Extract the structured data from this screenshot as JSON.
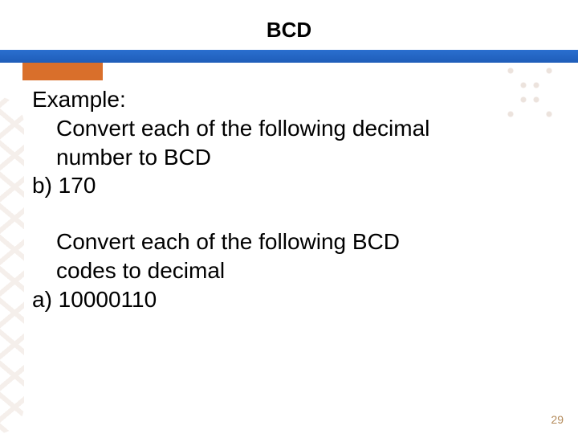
{
  "header": {
    "title": "BCD"
  },
  "content": {
    "example_label": "Example:",
    "task1_line1": "Convert each of the following  decimal",
    "task1_line2": "number to BCD",
    "item_b": "b) 170",
    "task2_line1": "Convert each of the following BCD",
    "task2_line2": "codes to decimal",
    "item_a": "a) 10000110"
  },
  "footer": {
    "page_number": "29"
  }
}
